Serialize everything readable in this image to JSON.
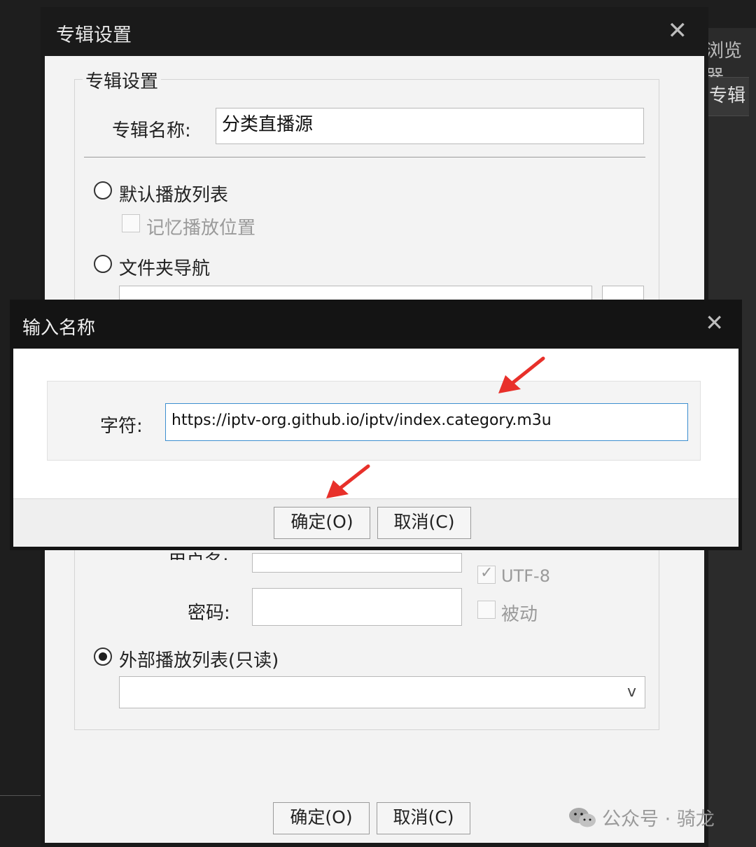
{
  "background": {
    "browser_label": "浏览器",
    "album_tab_label": "专辑"
  },
  "album_dialog": {
    "title": "专辑设置",
    "group_title": "专辑设置",
    "name_label": "专辑名称:",
    "name_value": "分类直播源",
    "default_playlist_label": "默认播放列表",
    "remember_position_label": "记忆播放位置",
    "folder_nav_label": "文件夹导航",
    "username_label": "用户名:",
    "password_label": "密码:",
    "utf8_label": "UTF-8",
    "passive_label": "被动",
    "external_playlist_label": "外部播放列表(只读)",
    "dropdown_chevron": "v",
    "ok_button": "确定(O)",
    "cancel_button": "取消(C)"
  },
  "input_dialog": {
    "title": "输入名称",
    "string_label": "字符:",
    "string_value": "https://iptv-org.github.io/iptv/index.category.m3u",
    "ok_button": "确定(O)",
    "cancel_button": "取消(C)"
  },
  "annotation_color": "#e8302a",
  "watermark": {
    "text": "公众号 · 骑龙",
    "icon": "wechat-icon"
  }
}
